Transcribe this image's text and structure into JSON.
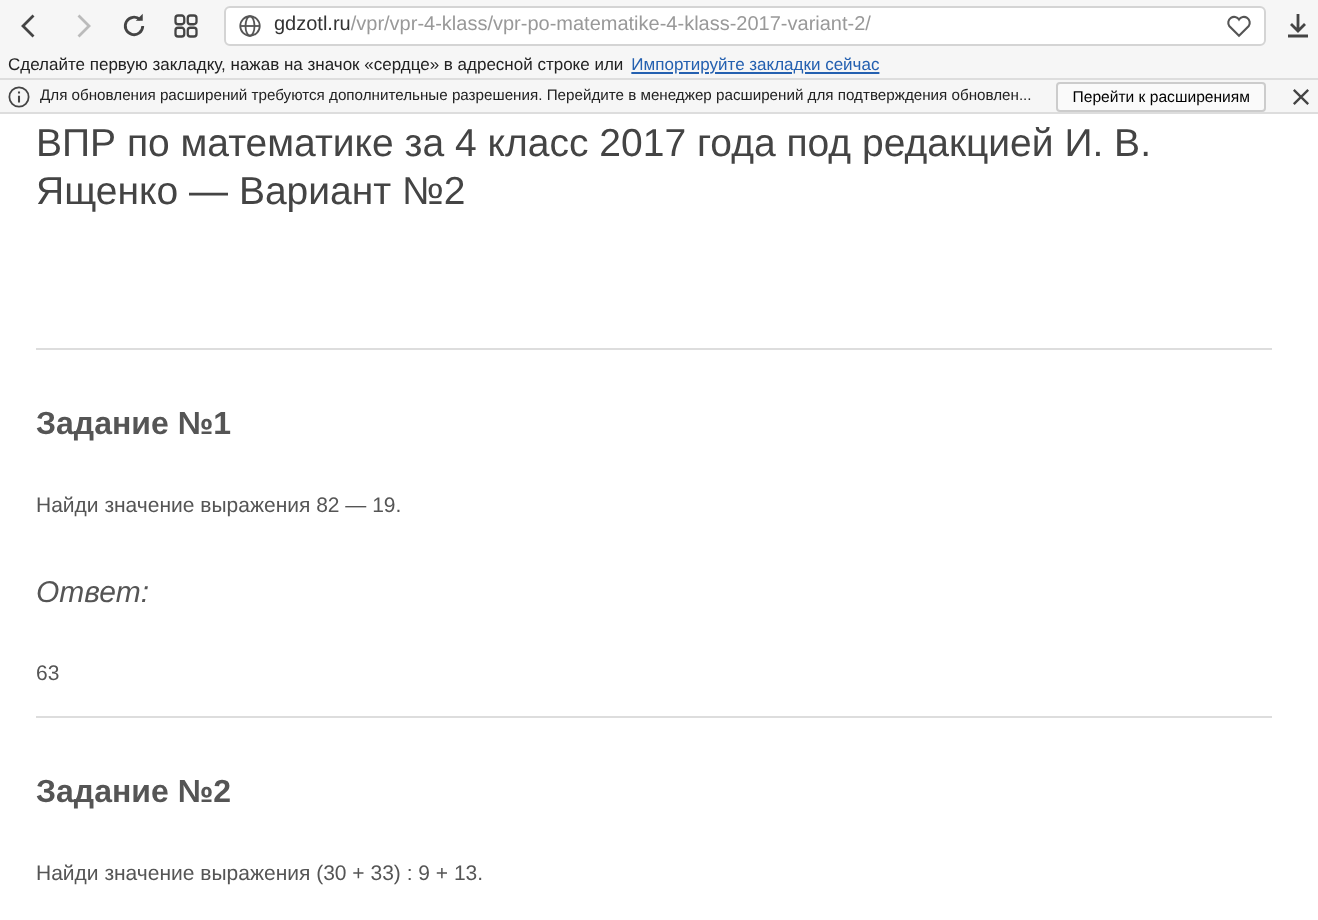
{
  "toolbar": {
    "nav_buttons": [
      {
        "kind": "back",
        "disabled": false
      },
      {
        "kind": "forward",
        "disabled": true
      },
      {
        "kind": "reload",
        "disabled": false
      },
      {
        "kind": "apps",
        "disabled": false
      }
    ],
    "address": {
      "host": "gdzotl.ru",
      "path": "/vpr/vpr-4-klass/vpr-po-matematike-4-klass-2017-variant-2/"
    }
  },
  "bookmarks_bar": {
    "text": "Сделайте первую закладку, нажав на значок «сердце» в адресной строке или",
    "link": "Импортируйте закладки сейчас"
  },
  "notification": {
    "text": "Для обновления расширений требуются дополнительные разрешения. Перейдите в менеджер расширений для подтверждения обновлен...",
    "button": "Перейти к расширениям"
  },
  "page": {
    "title": "ВПР по математике за 4 класс 2017 года под редакцией И. В. Ященко — Вариант №2",
    "tasks": [
      {
        "title": "Задание №1",
        "question": "Найди значение выражения 82 — 19.",
        "answer_label": "Ответ:",
        "answer": "63"
      },
      {
        "title": "Задание №2",
        "question": "Найди значение выражения (30 + 33) : 9 + 13."
      }
    ]
  }
}
